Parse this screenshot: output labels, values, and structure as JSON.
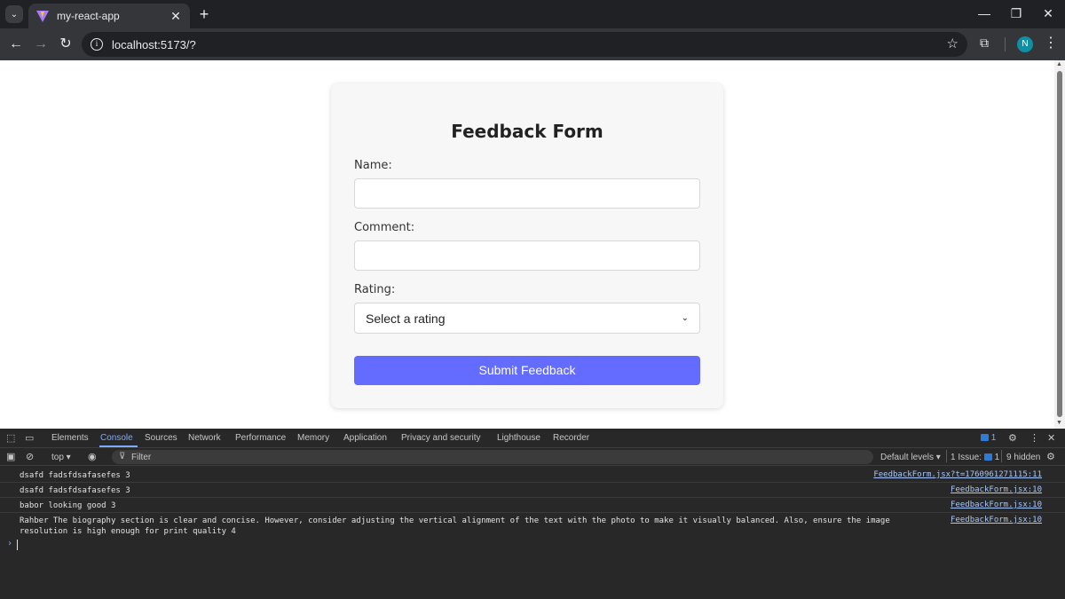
{
  "browser": {
    "tab_title": "my-react-app",
    "tab_close": "✕",
    "new_tab": "+",
    "url": "localhost:5173/?",
    "profile_initial": "N",
    "window_controls": {
      "minimize": "—",
      "maximize": "❐",
      "close": "✕"
    }
  },
  "form": {
    "title": "Feedback Form",
    "name_label": "Name:",
    "name_value": "",
    "comment_label": "Comment:",
    "comment_value": "",
    "rating_label": "Rating:",
    "rating_selected": "Select a rating",
    "submit_label": "Submit Feedback"
  },
  "devtools": {
    "tabs": [
      "Elements",
      "Console",
      "Sources",
      "Network",
      "Performance",
      "Memory",
      "Application",
      "Privacy and security",
      "Lighthouse",
      "Recorder"
    ],
    "active_tab": "Console",
    "messages_count": "1",
    "context": "top ▾",
    "filter_placeholder": "Filter",
    "levels": "Default levels ▾",
    "issues_label": "1 Issue:",
    "issues_count": "1",
    "hidden": "9 hidden",
    "logs": [
      {
        "message": "dsafd fadsfdsafasefes 3",
        "source": "FeedbackForm.jsx?t=1760961271115:11"
      },
      {
        "message": "dsafd fadsfdsafasefes 3",
        "source": "FeedbackForm.jsx:10"
      },
      {
        "message": "babor looking good 3",
        "source": "FeedbackForm.jsx:10"
      },
      {
        "message": "Rahber The biography section is clear and concise. However, consider adjusting the vertical alignment of the text with the photo to make it visually balanced. Also, ensure the image resolution is high enough for print quality 4",
        "source": "FeedbackForm.jsx:10"
      }
    ],
    "prompt": "›"
  },
  "colors": {
    "accent": "#646cff",
    "devtools_active": "#7cacf8",
    "link": "#a8c7fa"
  }
}
